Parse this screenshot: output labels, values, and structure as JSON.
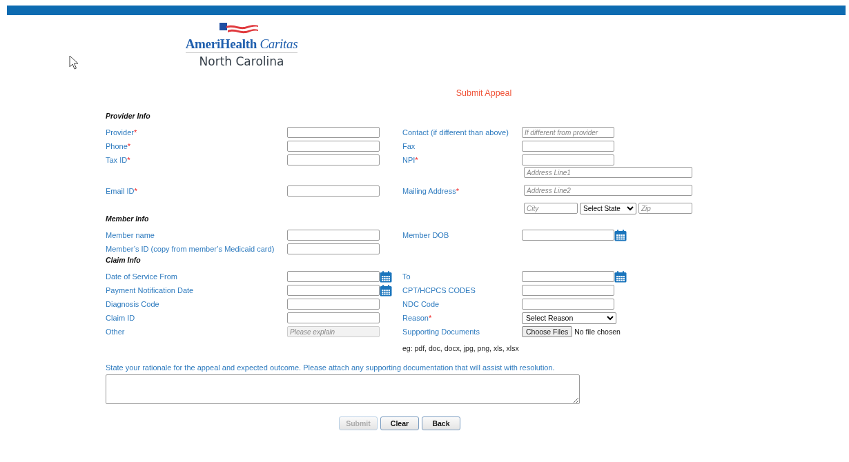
{
  "logo": {
    "brand": "AmeriHealth",
    "brand_italic": "Caritas",
    "region": "North Carolina"
  },
  "page_title": "Submit Appeal",
  "sections": [
    {
      "title": "Provider Info",
      "rows": [
        {
          "cells": [
            {
              "label": "Provider",
              "required_mark": "*",
              "field": {
                "kind": "text",
                "disabled": false
              }
            },
            {
              "label": "Contact (if different than above)",
              "field": {
                "kind": "text",
                "placeholder": "If different from provider",
                "disabled": false
              }
            }
          ]
        },
        {
          "cells": [
            {
              "label": "Phone",
              "required_mark": "*",
              "field": {
                "kind": "text",
                "disabled": false
              }
            },
            {
              "label": "Fax",
              "field": {
                "kind": "text",
                "disabled": false
              }
            }
          ]
        },
        {
          "cells": [
            {
              "label": "Tax ID",
              "required_mark": "*",
              "field": {
                "kind": "text",
                "disabled": false
              }
            },
            {
              "label": "NPI",
              "required_mark": "*",
              "field": {
                "kind": "text",
                "disabled": false
              }
            }
          ]
        },
        {
          "cells": [
            {
              "label": "Email ID",
              "required_mark": "*",
              "field": {
                "kind": "text",
                "disabled": false
              }
            },
            {
              "label": "Mailing Address",
              "required_mark": "*",
              "field": {
                "kind": "address",
                "line1_placeholder": "Address Line1",
                "line2_placeholder": "Address Line2",
                "city_placeholder": "City",
                "state_value": "Select State",
                "zip_placeholder": "Zip"
              }
            }
          ]
        }
      ]
    },
    {
      "title": "Member Info",
      "rows": [
        {
          "cells": [
            {
              "label": "Member name",
              "field": {
                "kind": "text",
                "disabled": false
              }
            },
            {
              "label": "Member DOB",
              "field": {
                "kind": "date",
                "disabled": false
              }
            }
          ]
        },
        {
          "cells": [
            {
              "label": "Member’s ID (copy from member’s Medicaid card)",
              "field": {
                "kind": "text",
                "disabled": false
              }
            }
          ]
        }
      ]
    },
    {
      "title": "Claim Info",
      "rows": [
        {
          "cells": [
            {
              "label": "Date of Service From",
              "field": {
                "kind": "date",
                "disabled": false
              }
            },
            {
              "label": "To",
              "field": {
                "kind": "date",
                "disabled": false
              }
            }
          ]
        },
        {
          "cells": [
            {
              "label": "Payment Notification Date",
              "field": {
                "kind": "date",
                "disabled": false
              }
            },
            {
              "label": "CPT/HCPCS CODES",
              "field": {
                "kind": "text",
                "disabled": false
              }
            }
          ]
        },
        {
          "cells": [
            {
              "label": "Diagnosis Code",
              "field": {
                "kind": "text",
                "disabled": false
              }
            },
            {
              "label": "NDC Code",
              "field": {
                "kind": "text",
                "disabled": false
              }
            }
          ]
        },
        {
          "cells": [
            {
              "label": "Claim ID",
              "field": {
                "kind": "text",
                "disabled": false
              }
            },
            {
              "label": "Reason",
              "required_mark": "*",
              "field": {
                "kind": "select",
                "value": "Select Reason"
              }
            }
          ]
        },
        {
          "cells": [
            {
              "label": "Other",
              "field": {
                "kind": "text",
                "placeholder": "Please explain",
                "disabled": true
              }
            },
            {
              "label": "Supporting Documents",
              "field": {
                "kind": "file",
                "button": "Choose Files",
                "status": "No file chosen"
              }
            }
          ]
        }
      ],
      "note": "eg: pdf, doc, docx, jpg, png, xls, xlsx"
    }
  ],
  "rationale": {
    "label": "State your rationale for the appeal and expected outcome. Please attach any supporting documentation that will assist with resolution."
  },
  "buttons": [
    {
      "label": "Submit",
      "disabled": true
    },
    {
      "label": "Clear",
      "disabled": false
    },
    {
      "label": "Back",
      "disabled": false
    }
  ]
}
